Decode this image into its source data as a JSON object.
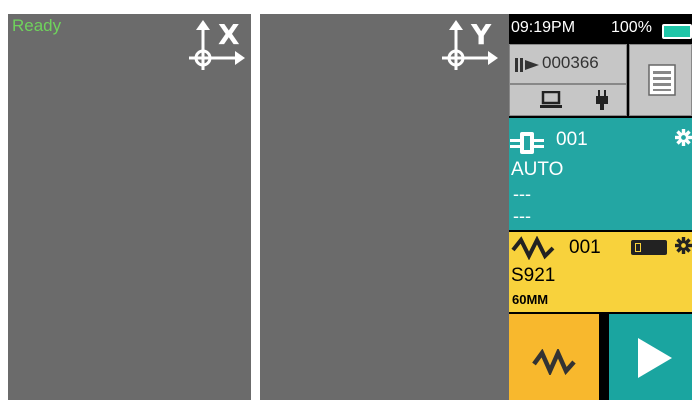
{
  "camera": {
    "status": "Ready",
    "x_axis_label": "X",
    "y_axis_label": "Y",
    "x_view_icon": "axis-crosshair-icon",
    "y_view_icon": "axis-crosshair-icon"
  },
  "status_bar": {
    "time": "09:19PM",
    "battery_percent": "100%",
    "battery_level": 1.0
  },
  "counter": {
    "value": "000366",
    "icon": "arc-counter-icon"
  },
  "power_icons": [
    "laptop-icon",
    "plug-icon"
  ],
  "menu_icon": "list-icon",
  "splice_program": {
    "number": "001",
    "mode": "AUTO",
    "detail_1": "---",
    "detail_2": "---",
    "icon": "fiber-icon",
    "settings_icon": "gear-icon"
  },
  "heat_program": {
    "number": "001",
    "name": "S921",
    "sleeve_length": "60MM",
    "icon": "heater-wave-icon",
    "settings_icon": "gear-icon"
  },
  "actions": {
    "heat_icon": "heater-wave-icon",
    "start_icon": "play-icon"
  },
  "colors": {
    "splice_card": "#23a6a3",
    "heat_card": "#f8d23c",
    "heat_button": "#f8b82d",
    "start_button": "#1aa5a0",
    "ready_text": "#6fd35c",
    "camera_bg": "#6b6b6b"
  }
}
